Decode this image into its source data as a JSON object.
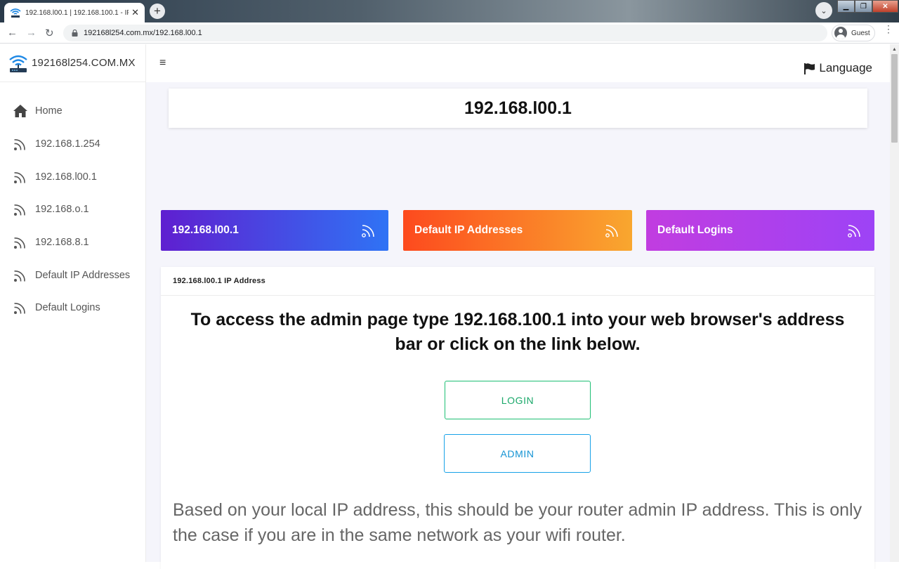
{
  "browser": {
    "tab_title": "192.168.l00.1 | 192.168.100.1 - IP",
    "tab_close": "✕",
    "new_tab": "+",
    "url": "192168l254.com.mx/192.168.l00.1",
    "profile_label": "Guest",
    "back": "←",
    "forward": "→",
    "reload": "↻",
    "tab_search": "⌄",
    "window_minimize": "▁",
    "window_maximize": "❐",
    "window_close": "✕",
    "menu": "⋮"
  },
  "sidebar": {
    "brand": "192168l254.COM.MX",
    "items": [
      {
        "label": "Home",
        "icon": "home-icon"
      },
      {
        "label": "192.168.1.254",
        "icon": "rss-icon"
      },
      {
        "label": "192.168.l00.1",
        "icon": "rss-icon"
      },
      {
        "label": "192.168.o.1",
        "icon": "rss-icon"
      },
      {
        "label": "192.168.8.1",
        "icon": "rss-icon"
      },
      {
        "label": "Default IP Addresses",
        "icon": "rss-icon"
      },
      {
        "label": "Default Logins",
        "icon": "rss-icon"
      }
    ]
  },
  "topbar": {
    "menu_toggle": "≡",
    "language": "Language"
  },
  "title": "192.168.l00.1",
  "quick_cards": [
    {
      "label": "192.168.l00.1",
      "colors": [
        "#5f1fd0",
        "#2f73f5"
      ]
    },
    {
      "label": "Default IP Addresses",
      "colors": [
        "#fd4a1e",
        "#f9a72f"
      ]
    },
    {
      "label": "Default Logins",
      "colors": [
        "#c13de0",
        "#9d43f6"
      ]
    }
  ],
  "main_card": {
    "header": "192.168.l00.1 IP Address",
    "lead": "To access the admin page type 192.168.100.1 into your web browser's address bar or click on the link below.",
    "login_button": "LOGIN",
    "admin_button": "ADMIN",
    "note": "Based on your local IP address, this should be your router admin IP address. This is only the case if you are in the same network as your wifi router."
  },
  "colors": {
    "login": "#1dbf73",
    "admin": "#17a2e8",
    "page_bg": "#f5f5fb"
  }
}
